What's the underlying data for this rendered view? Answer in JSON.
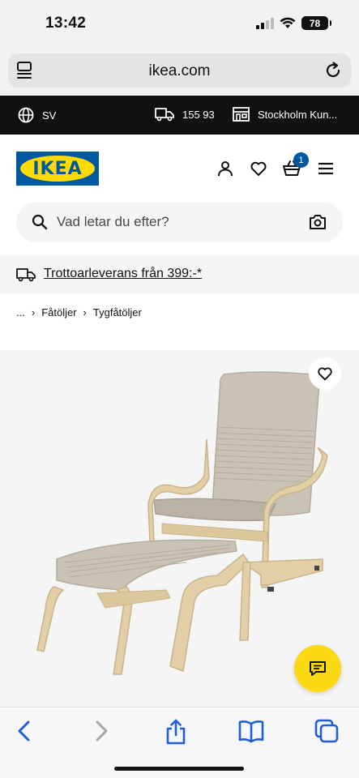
{
  "status_bar": {
    "time": "13:42",
    "battery": "78"
  },
  "browser": {
    "url": "ikea.com"
  },
  "topbar": {
    "language": "SV",
    "postal_code": "155 93",
    "store": "Stockholm Kun..."
  },
  "header": {
    "logo_text": "IKEA",
    "cart_count": "1"
  },
  "search": {
    "placeholder": "Vad letar du efter?"
  },
  "delivery_banner": {
    "text": "Trottoarleverans från 399:-*"
  },
  "breadcrumb": {
    "items": [
      "...",
      "Fåtöljer",
      "Tygfåtöljer"
    ]
  },
  "colors": {
    "ikea_blue": "#0058a3",
    "ikea_yellow": "#ffdb00",
    "chat_yellow": "#fbd914",
    "ios_blue": "#1f5fd6"
  }
}
